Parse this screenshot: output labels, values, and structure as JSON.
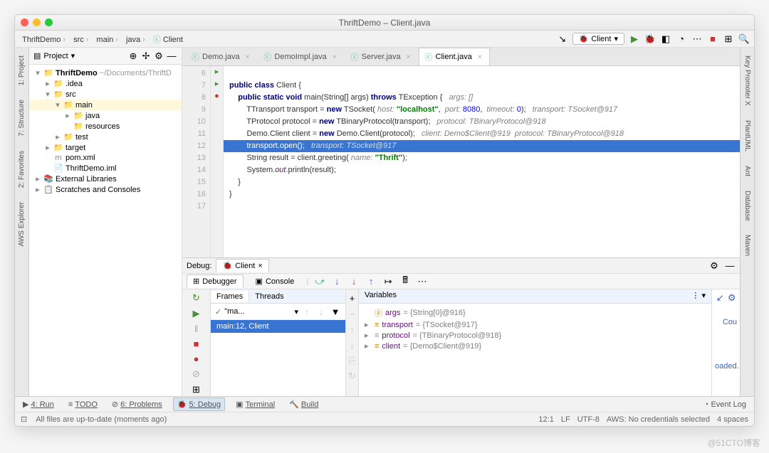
{
  "title": "ThriftDemo – Client.java",
  "breadcrumbs": [
    "ThriftDemo",
    "src",
    "main",
    "java",
    "Client"
  ],
  "runconfig": "Client",
  "rails": {
    "left": [
      "1: Project",
      "7: Structure",
      "2: Favorites",
      "AWS Explorer"
    ],
    "right": [
      "Key Promoter X",
      "PlantUML",
      "Ant",
      "Database",
      "Maven"
    ]
  },
  "sidebar": {
    "head": "Project",
    "tree": [
      {
        "d": 0,
        "tw": "▾",
        "ic": "📁",
        "label": "ThriftDemo",
        "suffix": "~/Documents/ThriftD",
        "bold": true
      },
      {
        "d": 1,
        "tw": "▸",
        "ic": "📁",
        "label": ".idea"
      },
      {
        "d": 1,
        "tw": "▾",
        "ic": "📁",
        "label": "src"
      },
      {
        "d": 2,
        "tw": "▾",
        "ic": "📁",
        "label": "main",
        "sel": true
      },
      {
        "d": 3,
        "tw": "▸",
        "ic": "📁",
        "label": "java",
        "blue": true
      },
      {
        "d": 3,
        "tw": "",
        "ic": "📁",
        "label": "resources"
      },
      {
        "d": 2,
        "tw": "▸",
        "ic": "📁",
        "label": "test"
      },
      {
        "d": 1,
        "tw": "▸",
        "ic": "📁",
        "label": "target",
        "orange": true
      },
      {
        "d": 1,
        "tw": "",
        "ic": "m",
        "label": "pom.xml"
      },
      {
        "d": 1,
        "tw": "",
        "ic": "📄",
        "label": "ThriftDemo.iml"
      },
      {
        "d": 0,
        "tw": "▸",
        "ic": "📚",
        "label": "External Libraries"
      },
      {
        "d": 0,
        "tw": "▸",
        "ic": "📋",
        "label": "Scratches and Consoles"
      }
    ]
  },
  "tabs": [
    {
      "label": "Demo.java"
    },
    {
      "label": "DemoImpl.java"
    },
    {
      "label": "Server.java"
    },
    {
      "label": "Client.java",
      "active": true
    }
  ],
  "code": {
    "start": 6,
    "gutIcons": {
      "7": "▸",
      "8": "▸",
      "12": "●"
    },
    "lines": [
      "",
      "<span class='kw'>public class</span> Client {",
      "    <span class='kw'>public static void</span> main(String[] args) <span class='kw'>throws</span> TException {   <span class='cm'>args: []</span>",
      "        TTransport transport = <span class='kw'>new</span> TSocket( <span class='cm'>host:</span> <span class='st'>\"localhost\"</span>,  <span class='cm'>port:</span> <span class='nm'>8080</span>,  <span class='cm'>timeout:</span> <span class='nm'>0</span>);   <span class='cm'>transport: TSocket@917</span>",
      "        TProtocol protocol = <span class='kw'>new</span> TBinaryProtocol(transport);   <span class='cm'>protocol: TBinaryProtocol@918</span>",
      "        Demo.Client client = <span class='kw'>new</span> Demo.Client(protocol);   <span class='cm'>client: Demo$Client@919  protocol: TBinaryProtocol@918</span>",
      "        transport.open();   <span class='cm'>transport: TSocket@917</span>",
      "        String result = client.greeting( <span class='cm'>name:</span> <span class='st'>\"Thrift\"</span>);",
      "        System.<span class='fi'>out</span>.println(result);",
      "    }",
      "}",
      ""
    ],
    "hl": 12
  },
  "debug": {
    "title": "Debug:",
    "tab": "Client",
    "subtabs": [
      "Debugger",
      "Console"
    ],
    "frameTabs": [
      "Frames",
      "Threads"
    ],
    "thread": "\"ma...",
    "frame": "main:12, Client",
    "varsTitle": "Variables",
    "vars": [
      {
        "tw": "",
        "ic": "ⓟ",
        "n": "args",
        "v": "= {String[0]@916}"
      },
      {
        "tw": "▸",
        "ic": "≡",
        "n": "transport",
        "v": "= {TSocket@917}"
      },
      {
        "tw": "▸",
        "ic": "≡",
        "n": "protocol",
        "v": "= {TBinaryProtocol@918}"
      },
      {
        "tw": "▸",
        "ic": "≡",
        "n": "client",
        "v": "= {Demo$Client@919}"
      }
    ],
    "rightMsgs": [
      "Cou",
      "oaded. L"
    ]
  },
  "bottomTabs": [
    {
      "l": "4: Run",
      "ic": "▶"
    },
    {
      "l": "TODO",
      "ic": "≡"
    },
    {
      "l": "6: Problems",
      "ic": "⊘"
    },
    {
      "l": "5: Debug",
      "ic": "🐞",
      "act": true
    },
    {
      "l": "Terminal",
      "ic": "▣"
    },
    {
      "l": "Build",
      "ic": "🔨"
    }
  ],
  "eventLog": "Event Log",
  "status": {
    "msg": "All files are up-to-date (moments ago)",
    "right": [
      "12:1",
      "LF",
      "UTF-8",
      "AWS: No credentials selected",
      "4 spaces"
    ]
  },
  "watermark": "@51CTO博客"
}
